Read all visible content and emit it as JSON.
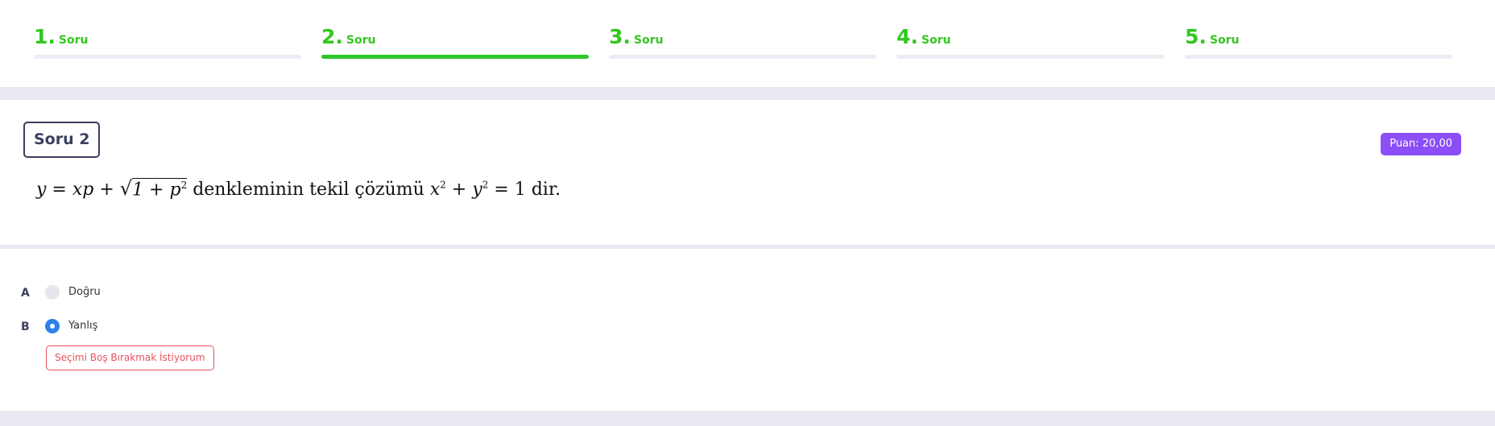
{
  "steps": [
    {
      "number": "1.",
      "label": "Soru",
      "active": false
    },
    {
      "number": "2.",
      "label": "Soru",
      "active": true
    },
    {
      "number": "3.",
      "label": "Soru",
      "active": false
    },
    {
      "number": "4.",
      "label": "Soru",
      "active": false
    },
    {
      "number": "5.",
      "label": "Soru",
      "active": false
    }
  ],
  "question": {
    "title": "Soru 2",
    "points": "Puan: 20,00",
    "equation_prefix": "y = xp + ",
    "sqrt_content": "1 + p",
    "sqrt_exponent": "2",
    "statement_middle": " denkleminin tekil çözümü ",
    "solution_x": "x",
    "solution_x_exp": "2",
    "solution_plus": " + ",
    "solution_y": "y",
    "solution_y_exp": "2",
    "solution_rhs": " = 1 ",
    "statement_end": "dir."
  },
  "options": [
    {
      "letter": "A",
      "label": "Doğru",
      "selected": false
    },
    {
      "letter": "B",
      "label": "Yanlış",
      "selected": true
    }
  ],
  "clear_button_label": "Seçimi Boş Bırakmak İstiyorum",
  "colors": {
    "step_active": "#2ec72a",
    "step_text": "#32c81e",
    "badge": "#8c4ef6",
    "radio_selected": "#2f80ed",
    "clear_button": "#e7515a"
  }
}
